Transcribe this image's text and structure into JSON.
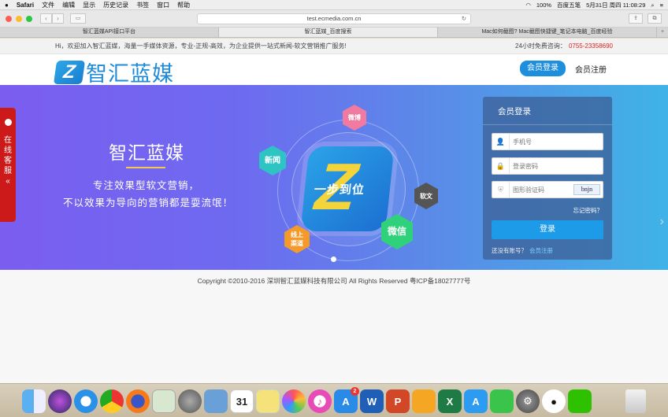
{
  "menubar": {
    "apple": "",
    "app": "Safari",
    "items": [
      "文件",
      "编辑",
      "显示",
      "历史记录",
      "书签",
      "窗口",
      "帮助"
    ],
    "battery": "100%",
    "input_method": "百度五笔",
    "datetime": "5月31日 周四  11:08:29"
  },
  "browser": {
    "url": "test.ecmedia.com.cn",
    "tabs": [
      "智汇蓝媒API接口平台",
      "智汇蓝媒_百度搜索",
      "Mac如何截图? Mac截图快捷键_笔记本电脑_百度经验"
    ]
  },
  "site": {
    "welcome": "Hi，欢迎加入智汇蓝媒，海量一手媒体资源，专业-正规-高效，为企业提供一站式新闻-软文营销推广服务!",
    "hotline_label": "24小时免费咨询：",
    "hotline": "0755-23358690",
    "logo_mark": "Z",
    "logo_text": "智汇蓝媒",
    "nav_login": "会员登录",
    "nav_register": "会员注册"
  },
  "banner": {
    "title": "智汇蓝媒",
    "subtitle1": "专注效果型软文营销，",
    "subtitle2": "不以效果为导向的营销都是耍流氓！",
    "center_caption": "一步到位",
    "center_mark": "Z",
    "hexes": {
      "weibo": "微博",
      "news": "新闻",
      "soft": "软文",
      "wechat": "微信",
      "online": "线上渠道"
    },
    "service": [
      "在",
      "线",
      "客",
      "服",
      "«"
    ]
  },
  "login": {
    "title": "会员登录",
    "phone_placeholder": "手机号",
    "password_placeholder": "登录密码",
    "captcha_placeholder": "图形验证码",
    "captcha_text": "bnjn",
    "forgot": "忘记密码？",
    "submit": "登录",
    "no_account": "还没有账号？",
    "register_link": "会员注册"
  },
  "footer": {
    "copyright": "Copyright ©2010-2016 深圳智汇蓝媒科技有限公司 All Rights Reserved 粤ICP备18027777号"
  },
  "dock": {
    "calendar_day": "31",
    "appstore_badge": "2"
  }
}
